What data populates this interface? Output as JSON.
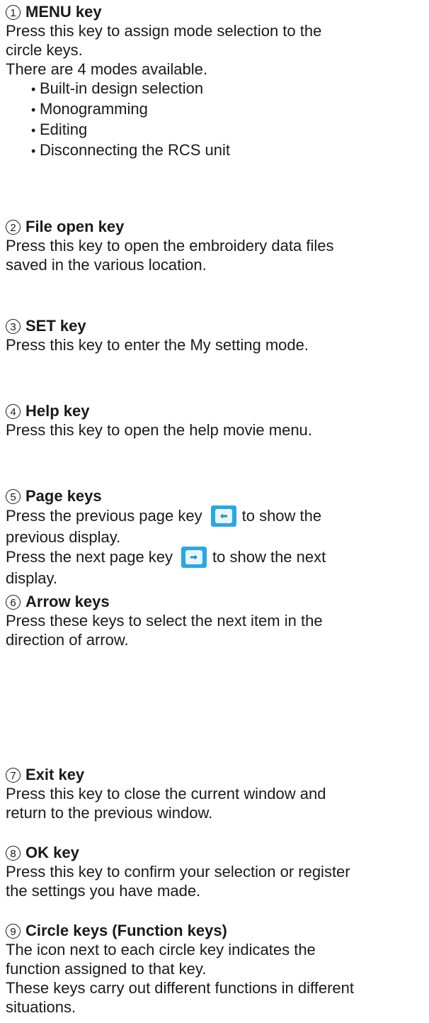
{
  "sections": [
    {
      "number": "1",
      "title": "MENU key",
      "lines": [
        "Press this key to assign mode selection to the",
        "circle keys.",
        "There are 4 modes available."
      ],
      "bullets": [
        "Built-in design selection",
        "Monogramming",
        "Editing",
        "Disconnecting the RCS unit"
      ]
    },
    {
      "number": "2",
      "title": "File open key",
      "lines": [
        "Press this key to open the embroidery data files",
        "saved in the various location."
      ]
    },
    {
      "number": "3",
      "title": "SET key",
      "lines": [
        "Press this key to enter the My setting mode."
      ]
    },
    {
      "number": "4",
      "title": "Help key",
      "lines": [
        "Press this key to open the help movie menu."
      ]
    },
    {
      "number": "5",
      "title": "Page keys",
      "prev_before": "Press the previous page key",
      "prev_after": "to show the",
      "prev_line2": "previous display.",
      "next_before": "Press the next page key",
      "next_after": "to show the next",
      "next_line2": "display.",
      "icons": [
        "previous-page-icon",
        "next-page-icon"
      ],
      "icon_color": "#29a8e0"
    },
    {
      "number": "6",
      "title": "Arrow keys",
      "lines": [
        "Press these keys to select the next item in the",
        "direction of arrow."
      ]
    },
    {
      "number": "7",
      "title": "Exit key",
      "lines": [
        "Press this key to close the current window and",
        "return to the previous window."
      ]
    },
    {
      "number": "8",
      "title": "OK key",
      "lines": [
        "Press this key to confirm your selection or register",
        "the settings you have made."
      ]
    },
    {
      "number": "9",
      "title": "Circle keys (Function keys)",
      "lines": [
        "The icon next to each circle key indicates the",
        "function assigned to that key.",
        "These keys carry out different functions in different",
        "situations."
      ]
    }
  ]
}
